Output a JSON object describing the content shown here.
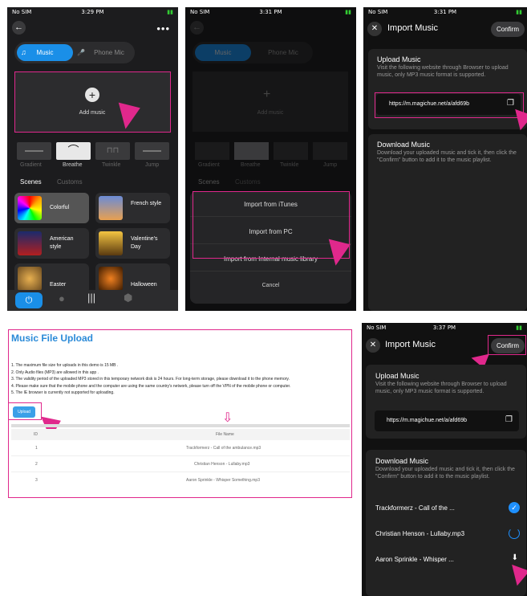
{
  "p1": {
    "status": {
      "carrier": "No SIM",
      "time": "3:29 PM"
    },
    "more": "•••",
    "tabs": [
      "Music",
      "Phone Mic"
    ],
    "add": "Add music",
    "modes": [
      "Gradient",
      "Breathe",
      "Twinkle",
      "Jump"
    ],
    "scene_tabs": [
      "Scenes",
      "Customs"
    ],
    "scenes": [
      "Colorful",
      "French style",
      "American style",
      "Valentine's Day",
      "Easter",
      "Halloween"
    ]
  },
  "p2": {
    "status": {
      "carrier": "No SIM",
      "time": "3:31 PM"
    },
    "tabs": [
      "Music",
      "Phone Mic"
    ],
    "add": "Add music",
    "modes": [
      "Gradient",
      "Breathe",
      "Twinkle",
      "Jump"
    ],
    "scene_tabs": [
      "Scenes",
      "Customs"
    ],
    "sheet": [
      "Import from iTunes",
      "Import from PC",
      "Import from Internal music library"
    ],
    "cancel": "Cancel"
  },
  "p3": {
    "status": {
      "carrier": "No SIM",
      "time": "3:31 PM"
    },
    "title": "Import Music",
    "confirm": "Confirm",
    "upload_title": "Upload Music",
    "upload_desc": "Visit the following website through Browser to upload music, only MP3 music format is supported.",
    "url": "https://m.magichue.net/a/afd69b",
    "download_title": "Download Music",
    "download_desc": "Download your uploaded music and tick it, then click the \"Confirm\" button to add it to the music playlist."
  },
  "web": {
    "title": "Music File Upload",
    "rules": [
      "1. The maximum file size for uploads in this demo is 15 MB .",
      "2. Only Audio files (MP3) are allowed in this app .",
      "3. The validity period of the uploaded MP3 stored in this temporary network disk is 24 hours. For long-term storage, please download it to the phone memory.",
      "4. Please make sure that the mobile phone and the computer are using the same country's network, please turn off the VPN of the mobile phone or computer.",
      "5. The IE browser is currently not supported for uploading."
    ],
    "upload": "Upload",
    "cols": [
      "ID",
      "File Name"
    ],
    "rows": [
      {
        "id": "1",
        "name": "Trackformerz - Call of the ambulance.mp3"
      },
      {
        "id": "2",
        "name": "Christian Henson - Lullaby.mp3"
      },
      {
        "id": "3",
        "name": "Aaron Sprinkle - Whisper Something.mp3"
      }
    ]
  },
  "p4": {
    "status": {
      "carrier": "No SIM",
      "time": "3:37 PM"
    },
    "title": "Import Music",
    "confirm": "Confirm",
    "upload_title": "Upload Music",
    "upload_desc": "Visit the following website through Browser to upload music, only MP3 music format is supported.",
    "url": "https://m.magichue.net/a/afd69b",
    "download_title": "Download Music",
    "download_desc": "Download your uploaded music and tick it, then click the \"Confirm\" button to add it to the music playlist.",
    "songs": [
      "Trackformerz - Call of the ...",
      "Christian Henson - Lullaby.mp3",
      "Aaron Sprinkle - Whisper ..."
    ]
  },
  "colors": {
    "accent": "#e0288c",
    "blue": "#1e90ff"
  }
}
